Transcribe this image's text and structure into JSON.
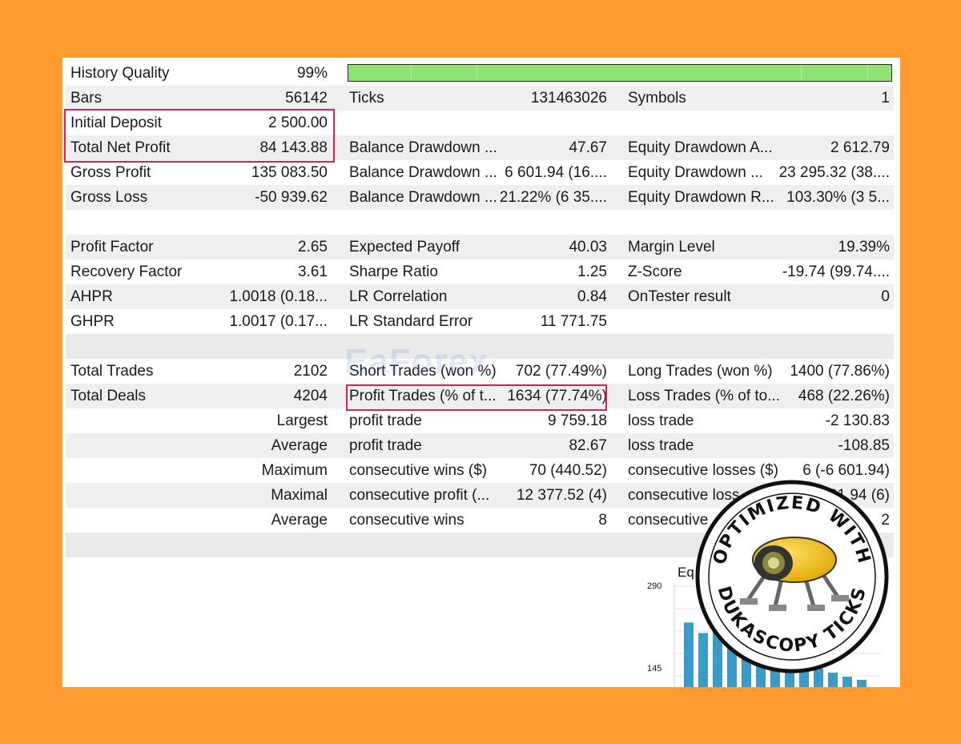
{
  "history_quality": {
    "label": "History Quality",
    "value": "99%",
    "fill": 1.0
  },
  "rows": [
    {
      "c1": [
        "Bars",
        "56142"
      ],
      "c2": [
        "Ticks",
        "131463026"
      ],
      "c3": [
        "Symbols",
        "1"
      ]
    },
    {
      "c1": [
        "Initial Deposit",
        "2 500.00"
      ],
      "c2": [
        "",
        ""
      ],
      "c3": [
        "",
        ""
      ]
    },
    {
      "c1": [
        "Total Net Profit",
        "84 143.88"
      ],
      "c2": [
        "Balance Drawdown ...",
        "47.67"
      ],
      "c3": [
        "Equity Drawdown A...",
        "2 612.79"
      ]
    },
    {
      "c1": [
        "Gross Profit",
        "135 083.50"
      ],
      "c2": [
        "Balance Drawdown ...",
        "6 601.94 (16...."
      ],
      "c3": [
        "Equity Drawdown ...",
        "23 295.32 (38...."
      ]
    },
    {
      "c1": [
        "Gross Loss",
        "-50 939.62"
      ],
      "c2": [
        "Balance Drawdown ...",
        "21.22% (6 35...."
      ],
      "c3": [
        "Equity Drawdown R...",
        "103.30% (3 5..."
      ]
    },
    {
      "blank": true
    },
    {
      "c1": [
        "Profit Factor",
        "2.65"
      ],
      "c2": [
        "Expected Payoff",
        "40.03"
      ],
      "c3": [
        "Margin Level",
        "19.39%"
      ]
    },
    {
      "c1": [
        "Recovery Factor",
        "3.61"
      ],
      "c2": [
        "Sharpe Ratio",
        "1.25"
      ],
      "c3": [
        "Z-Score",
        "-19.74 (99.74...."
      ]
    },
    {
      "c1": [
        "AHPR",
        "1.0018 (0.18..."
      ],
      "c2": [
        "LR Correlation",
        "0.84"
      ],
      "c3": [
        "OnTester result",
        "0"
      ]
    },
    {
      "c1": [
        "GHPR",
        "1.0017 (0.17..."
      ],
      "c2": [
        "LR Standard Error",
        "11 771.75"
      ],
      "c3": [
        "",
        ""
      ]
    },
    {
      "blank": true
    },
    {
      "c1": [
        "Total Trades",
        "2102"
      ],
      "c2": [
        "Short Trades (won %)",
        "702 (77.49%)"
      ],
      "c3": [
        "Long Trades (won %)",
        "1400 (77.86%)"
      ]
    },
    {
      "c1": [
        "Total Deals",
        "4204"
      ],
      "c2": [
        "Profit Trades (% of t...",
        "1634 (77.74%)"
      ],
      "c3": [
        "Loss Trades (% of to...",
        "468 (22.26%)"
      ]
    },
    {
      "right": "Largest",
      "c2": [
        "profit trade",
        "9 759.18"
      ],
      "c3": [
        "loss trade",
        "-2 130.83"
      ]
    },
    {
      "right": "Average",
      "c2": [
        "profit trade",
        "82.67"
      ],
      "c3": [
        "loss trade",
        "-108.85"
      ]
    },
    {
      "right": "Maximum",
      "c2": [
        "consecutive wins ($)",
        "70 (440.52)"
      ],
      "c3": [
        "consecutive losses ($)",
        "6 (-6 601.94)"
      ]
    },
    {
      "right": "Maximal",
      "c2": [
        "consecutive profit (...",
        "12 377.52 (4)"
      ],
      "c3": [
        "consecutive loss",
        "-6 601.94 (6)"
      ]
    },
    {
      "right": "Average",
      "c2": [
        "consecutive wins",
        "8"
      ],
      "c3": [
        "consecutive",
        "2"
      ]
    },
    {
      "blank": true
    }
  ],
  "watermark": "EaForex",
  "mini_chart": {
    "title": "Eq",
    "y_ticks": [
      "290",
      "145"
    ],
    "bars": [
      0.62,
      0.52,
      0.55,
      0.5,
      0.45,
      0.4,
      0.34,
      0.28,
      0.22,
      0.18,
      0.14,
      0.1,
      0.07
    ],
    "bar_color": "#3A9BC7"
  },
  "badge": {
    "top_text": "OPTIMIZED WITH",
    "bottom_text": "DUKASCOPY TICKS"
  },
  "colors": {
    "background": "#FF9A2E",
    "highlight": "#D9234D",
    "quality_bar": "#8FE370"
  }
}
